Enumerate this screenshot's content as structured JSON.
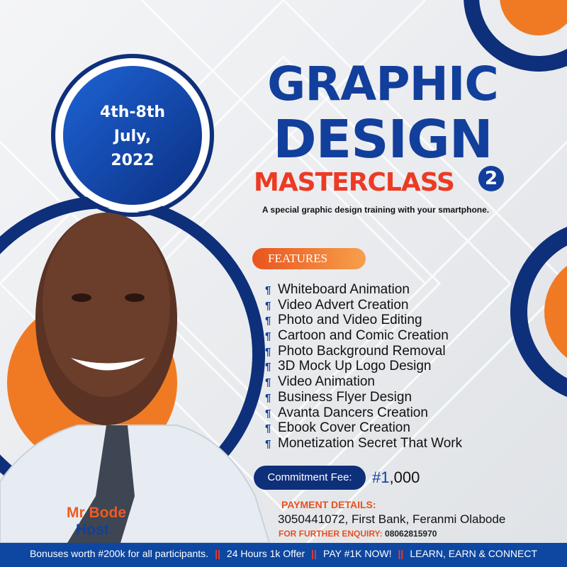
{
  "event": {
    "date_line1": "4th-8th",
    "date_line2": "July,",
    "date_line3": "2022"
  },
  "title": {
    "line1": "GRAPHIC",
    "line2": "DESIGN",
    "line3": "MASTERCLASS",
    "edition": "2",
    "subtitle": "A special graphic design training with your smartphone."
  },
  "features": {
    "heading": "FEATURES",
    "items": [
      "Whiteboard Animation",
      "Video Advert Creation",
      "Photo and Video Editing",
      "Cartoon and Comic Creation",
      "Photo Background Removal",
      "3D Mock Up Logo Design",
      "Video Animation",
      "Business Flyer Design",
      "Avanta Dancers Creation",
      "Ebook Cover Creation",
      "Monetization Secret That Work"
    ]
  },
  "fee": {
    "label": "Commitment Fee:",
    "hash": "#1",
    "amount": ",000"
  },
  "payment": {
    "heading": "PAYMENT DETAILS:",
    "details": "3050441072, First Bank, Feranmi Olabode",
    "enquiry_label": "FOR FURTHER ENQUIRY:",
    "enquiry_number": "08062815970"
  },
  "host": {
    "name": "Mr Bode",
    "role": "Host"
  },
  "footer": {
    "item1": "Bonuses worth #200k for all participants.",
    "item2": "24 Hours 1k Offer",
    "item3": "PAY #1K NOW!",
    "item4": "LEARN, EARN & CONNECT",
    "separator": "||"
  },
  "colors": {
    "brand_blue": "#123f9c",
    "accent_orange": "#ef5a24",
    "footer_blue": "#0d47a1"
  }
}
